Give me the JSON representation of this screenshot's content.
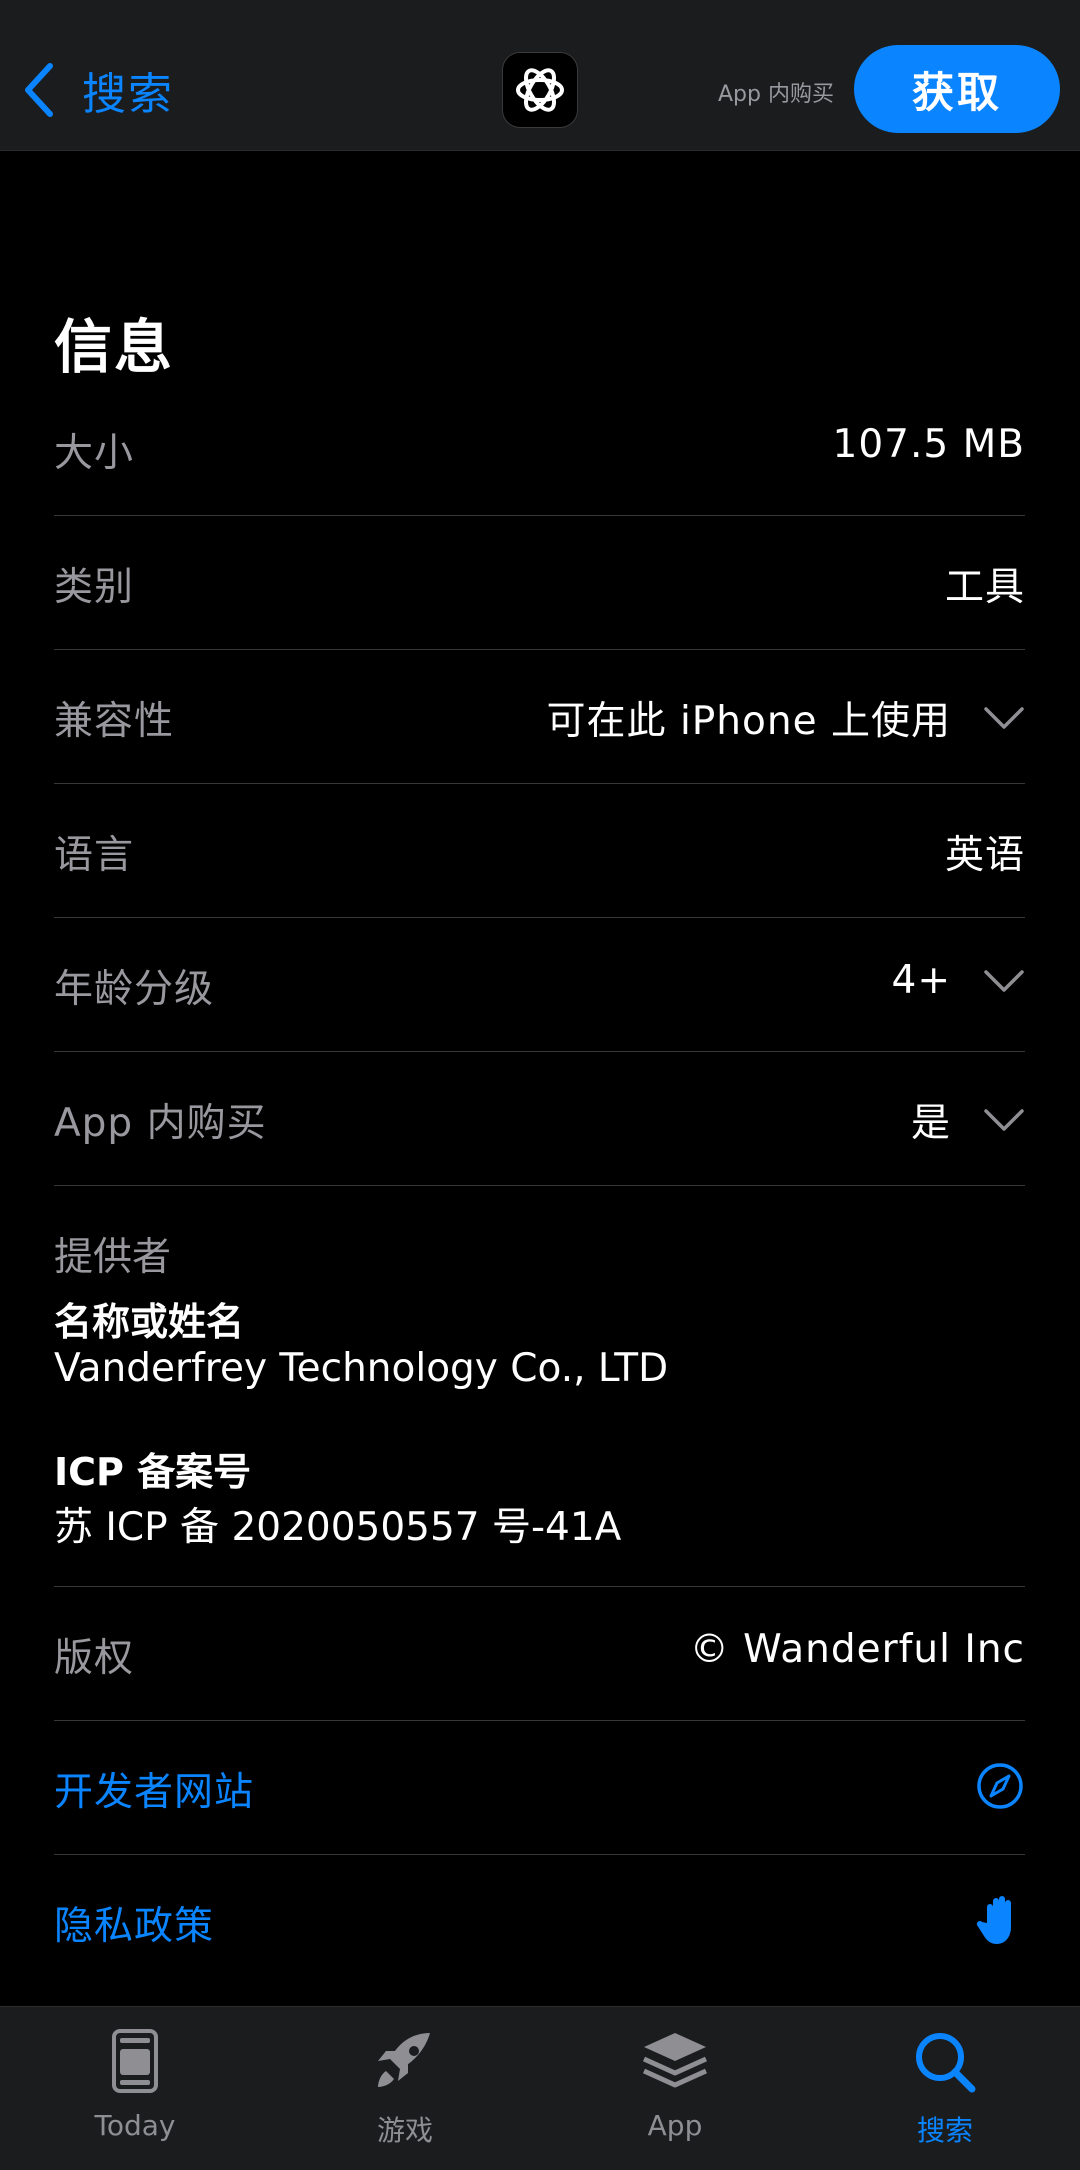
{
  "nav": {
    "back_label": "搜索",
    "iap_note": "App 内购买",
    "get_label": "获取"
  },
  "section": {
    "title": "信息"
  },
  "rows": [
    {
      "label": "大小",
      "value": "107.5 MB"
    },
    {
      "label": "类别",
      "value": "工具"
    },
    {
      "label": "兼容性",
      "value": "可在此 iPhone 上使用"
    },
    {
      "label": "语言",
      "value": "英语"
    },
    {
      "label": "年龄分级",
      "value": "4+"
    },
    {
      "label": "App 内购买",
      "value": "是"
    }
  ],
  "provider": {
    "label": "提供者",
    "name_heading": "名称或姓名",
    "name_value": "Vanderfrey Technology Co., LTD",
    "icp_heading": "ICP 备案号",
    "icp_value": "苏 ICP 备 2020050557 号-41A"
  },
  "copyright": {
    "label": "版权",
    "value": "© Wanderful Inc"
  },
  "links": {
    "developer_site": "开发者网站",
    "privacy_policy": "隐私政策"
  },
  "tabbar": {
    "items": [
      {
        "label": "Today",
        "icon": "today-icon"
      },
      {
        "label": "游戏",
        "icon": "rocket-icon"
      },
      {
        "label": "App",
        "icon": "app-stack-icon"
      },
      {
        "label": "搜索",
        "icon": "search-icon",
        "active": true
      }
    ]
  },
  "colors": {
    "accent": "#0a84ff",
    "background": "#000000",
    "secondary_text": "#98989e"
  }
}
